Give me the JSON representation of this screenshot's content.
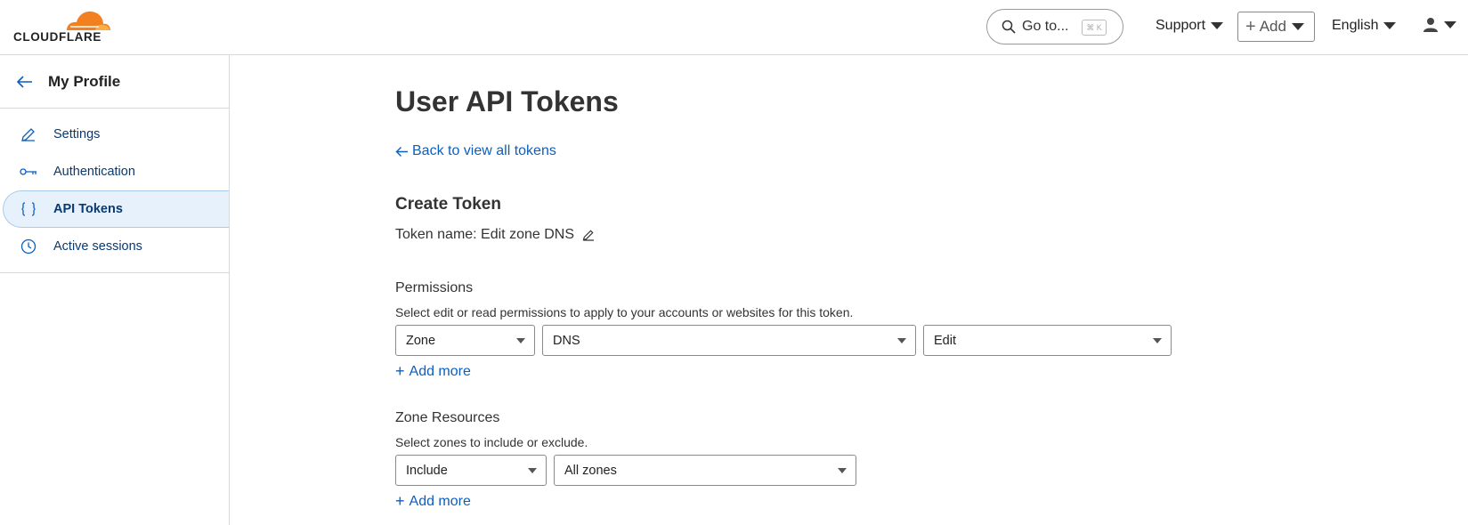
{
  "brand": {
    "logo_text": "CLOUDFLARE",
    "accent": "#f38020"
  },
  "topbar": {
    "goto_label": "Go to...",
    "goto_shortcut": "⌘ K",
    "support_label": "Support",
    "add_label": "Add",
    "language_label": "English"
  },
  "sidebar": {
    "title": "My Profile",
    "items": [
      {
        "label": "Settings",
        "icon": "pencil-icon",
        "active": false
      },
      {
        "label": "Authentication",
        "icon": "key-icon",
        "active": false
      },
      {
        "label": "API Tokens",
        "icon": "braces-icon",
        "active": true
      },
      {
        "label": "Active sessions",
        "icon": "clock-icon",
        "active": false
      }
    ]
  },
  "main": {
    "title": "User API Tokens",
    "back_link": "Back to view all tokens",
    "section_title": "Create Token",
    "token_name": "Token name: Edit zone DNS",
    "permissions": {
      "label": "Permissions",
      "help": "Select edit or read permissions to apply to your accounts or websites for this token.",
      "selects": [
        "Zone",
        "DNS",
        "Edit"
      ],
      "add_more": "Add more"
    },
    "zone_resources": {
      "label": "Zone Resources",
      "help": "Select zones to include or exclude.",
      "selects": [
        "Include",
        "All zones"
      ],
      "add_more": "Add more"
    }
  },
  "colors": {
    "link": "#0a5fbf",
    "active_bg": "#e7f1fb",
    "nav_text": "#0b3a6e"
  }
}
